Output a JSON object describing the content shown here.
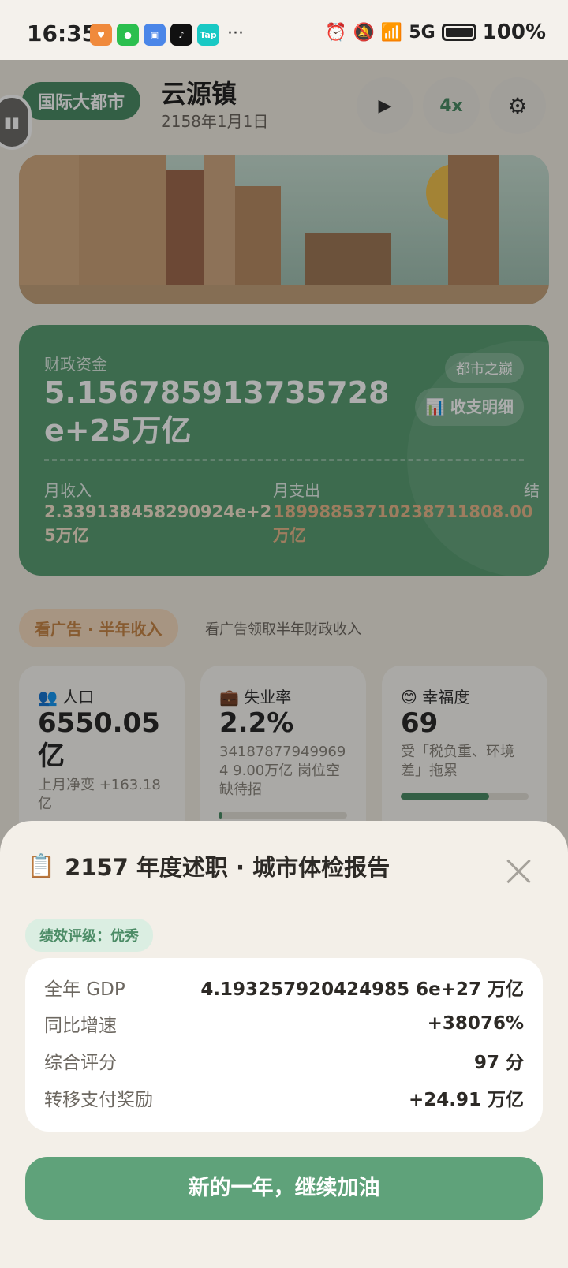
{
  "status_bar": {
    "time": "16:35",
    "apps": [
      {
        "name": "heart-app-icon",
        "label": "",
        "color": "#f08a3c"
      },
      {
        "name": "wechat-icon",
        "label": "",
        "color": "#2bbf4e"
      },
      {
        "name": "blue-app-icon",
        "label": "",
        "color": "#4a86e8"
      },
      {
        "name": "tiktok-icon",
        "label": "",
        "color": "#111111"
      },
      {
        "name": "taptap-icon",
        "label": "Tap",
        "color": "#19c9c4"
      }
    ],
    "more": "···",
    "battery": "100%"
  },
  "header": {
    "city_level": "国际大都市",
    "town_name": "云源镇",
    "date": "2158年1月1日",
    "play_label": "▶",
    "speed_label": "4x",
    "settings_icon": "⚙"
  },
  "finance": {
    "label": "财政资金",
    "value": "5.156785913735728e+25万亿",
    "tag": "都市之巅",
    "detail_button": "📊 收支明细",
    "income_label": "月收入",
    "income_value": "2.339138458290924e+25万亿",
    "expense_label": "月支出",
    "expense_value": "18998853710238711808.00万亿",
    "third_label": "结"
  },
  "ad": {
    "button": "看广告 · 半年收入",
    "description": "看广告领取半年财政收入"
  },
  "stats": [
    {
      "icon": "👥",
      "title": "人口",
      "value": "6550.05亿",
      "sub": "上月净变 +163.18亿"
    },
    {
      "icon": "💼",
      "title": "失业率",
      "value": "2.2%",
      "sub": "341878779499694 9.00万亿 岗位空缺待招",
      "bar": 0.02
    },
    {
      "icon": "😊",
      "title": "幸福度",
      "value": "69",
      "sub": "受「税负重、环境差」拖累",
      "bar": 0.69
    }
  ],
  "report": {
    "icon": "📋",
    "title": "2157 年度述职 · 城市体检报告",
    "grade": "绩效评级：优秀",
    "rows": [
      {
        "label": "全年 GDP",
        "value": "4.193257920424985 6e+27 万亿"
      },
      {
        "label": "同比增速",
        "value": "+38076%"
      },
      {
        "label": "综合评分",
        "value": "97 分"
      },
      {
        "label": "转移支付奖励",
        "value": "+24.91 万亿"
      }
    ],
    "cta": "新的一年，继续加油"
  }
}
